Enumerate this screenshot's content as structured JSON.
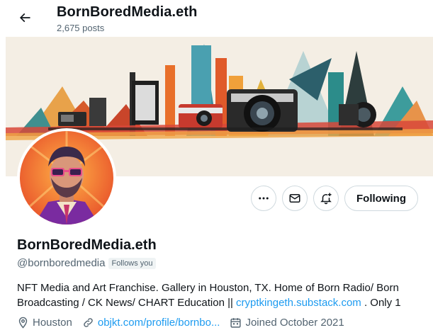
{
  "header": {
    "title": "BornBoredMedia.eth",
    "post_count": "2,675 posts"
  },
  "actions": {
    "more_icon": "more-icon",
    "message_icon": "mail-icon",
    "notify_icon": "bell-plus-icon",
    "following_label": "Following"
  },
  "profile": {
    "name": "BornBoredMedia.eth",
    "handle": "@bornboredmedia",
    "follows_you": "Follows you",
    "bio_text": "NFT Media and Art Franchise. Gallery in Houston, TX. Home of Born Radio/ Born Broadcasting / CK News/ CHART Education || ",
    "bio_link": "cryptkingeth.substack.com",
    "bio_tail": " . Only 1",
    "location": "Houston",
    "website": "objkt.com/profile/bornbo...",
    "joined": "Joined October 2021"
  },
  "colors": {
    "accent": "#1d9bf0",
    "muted": "#536471",
    "text": "#0f1419"
  }
}
